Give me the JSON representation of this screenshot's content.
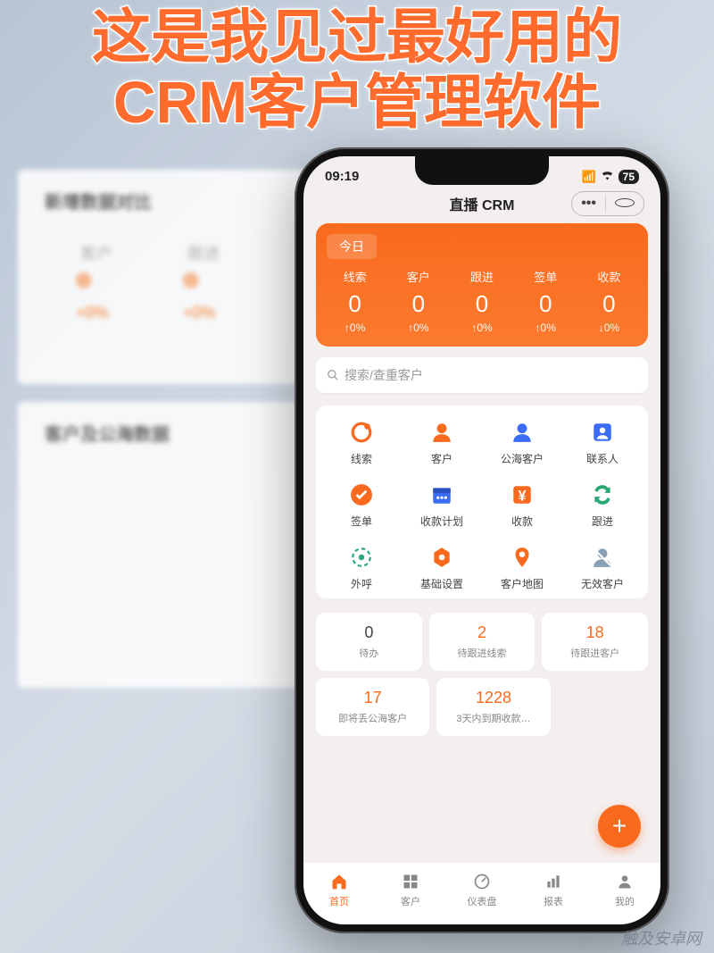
{
  "headline": {
    "line1": "这是我见过最好用的",
    "line2": "CRM客户管理软件"
  },
  "bg": {
    "section1": "新增数据对比",
    "col1": "客户",
    "col2": "跟进",
    "pct1": "+0%",
    "pct2": "+0%",
    "section2": "客户及公海数据"
  },
  "status": {
    "time": "09:19",
    "battery": "75"
  },
  "app": {
    "title": "直播 CRM"
  },
  "today": {
    "label": "今日",
    "stats": [
      {
        "label": "线索",
        "value": "0",
        "delta": "↑0%"
      },
      {
        "label": "客户",
        "value": "0",
        "delta": "↑0%"
      },
      {
        "label": "跟进",
        "value": "0",
        "delta": "↑0%"
      },
      {
        "label": "签单",
        "value": "0",
        "delta": "↑0%"
      },
      {
        "label": "收款",
        "value": "0",
        "delta": "↓0%"
      }
    ]
  },
  "search": {
    "placeholder": "搜索/查重客户"
  },
  "grid": [
    {
      "name": "leads",
      "label": "线索",
      "color": "#fa6a1e",
      "glyph": "lead"
    },
    {
      "name": "customers",
      "label": "客户",
      "color": "#fa6a1e",
      "glyph": "person"
    },
    {
      "name": "pool",
      "label": "公海客户",
      "color": "#3b6cf5",
      "glyph": "person"
    },
    {
      "name": "contacts",
      "label": "联系人",
      "color": "#3b6cf5",
      "glyph": "contact"
    },
    {
      "name": "deals",
      "label": "签单",
      "color": "#fa6a1e",
      "glyph": "check"
    },
    {
      "name": "plan",
      "label": "收款计划",
      "color": "#3b6cf5",
      "glyph": "calendar"
    },
    {
      "name": "receipt",
      "label": "收款",
      "color": "#fa6a1e",
      "glyph": "yen"
    },
    {
      "name": "follow",
      "label": "跟进",
      "color": "#2aa876",
      "glyph": "swap"
    },
    {
      "name": "call",
      "label": "外呼",
      "color": "#2aa876",
      "glyph": "ring"
    },
    {
      "name": "settings",
      "label": "基础设置",
      "color": "#fa6a1e",
      "glyph": "gear"
    },
    {
      "name": "map",
      "label": "客户地图",
      "color": "#fa6a1e",
      "glyph": "pin"
    },
    {
      "name": "invalid",
      "label": "无效客户",
      "color": "#8aa0b4",
      "glyph": "person-x"
    }
  ],
  "tiles": [
    {
      "num": "0",
      "cap": "待办",
      "cls": "num-dark"
    },
    {
      "num": "2",
      "cap": "待跟进线索",
      "cls": "num-red"
    },
    {
      "num": "18",
      "cap": "待跟进客户",
      "cls": "num-red"
    },
    {
      "num": "17",
      "cap": "即将丢公海客户",
      "cls": "num-orange"
    },
    {
      "num": "1228",
      "cap": "3天内到期收款…",
      "cls": "num-orange"
    }
  ],
  "tabs": [
    {
      "name": "home",
      "label": "首页",
      "active": true
    },
    {
      "name": "customers",
      "label": "客户",
      "active": false
    },
    {
      "name": "dashboard",
      "label": "仪表盘",
      "active": false
    },
    {
      "name": "reports",
      "label": "报表",
      "active": false
    },
    {
      "name": "me",
      "label": "我的",
      "active": false
    }
  ],
  "watermark": "触及安卓网"
}
